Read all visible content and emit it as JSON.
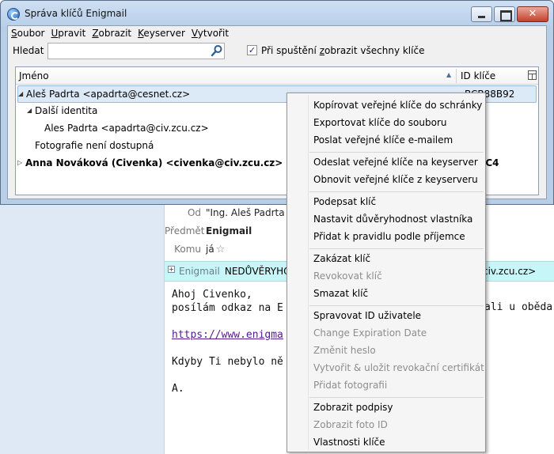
{
  "dialog": {
    "title": "Správa klíčů Enigmail",
    "close_glyph": "✕",
    "menu": [
      {
        "label": "Soubor",
        "mnemonic": "S",
        "rest": "oubor"
      },
      {
        "label": "Upravit",
        "mnemonic": "U",
        "rest": "pravit"
      },
      {
        "label": "Zobrazit",
        "mnemonic": "Z",
        "rest": "obrazit"
      },
      {
        "label": "Keyserver",
        "mnemonic": "K",
        "rest": "eyserver"
      },
      {
        "label": "Vytvořit",
        "mnemonic": "V",
        "rest": "ytvořit"
      }
    ],
    "search": {
      "label": "Hledat",
      "value": "",
      "placeholder": ""
    },
    "show_all_checkbox": {
      "checked": true,
      "check_glyph": "✓",
      "label_pre": "Při spuštění ",
      "label_mnemonic": "z",
      "label_post": "obrazit všechny klíče"
    },
    "tree": {
      "col_name": "Jméno",
      "col_id": "ID klíče",
      "rows": [
        {
          "twisty": "◢",
          "text": "Aleš Padrta <apadrta@cesnet.cz>",
          "key_id": "BCB88B92",
          "selected": true,
          "bold": false
        },
        {
          "twisty": "◢",
          "text": "Další identita",
          "key_id": "",
          "selected": false,
          "bold": false
        },
        {
          "twisty": "",
          "text": "Ales Padrta <apadrta@civ.zcu.cz>",
          "key_id": "",
          "selected": false,
          "bold": false
        },
        {
          "twisty": "",
          "text": "Fotografie není dostupná",
          "key_id": "",
          "selected": false,
          "bold": false
        },
        {
          "twisty": "▷",
          "text": "Anna Nováková (Civenka) <civenka@civ.zcu.cz>",
          "key_id": "8C4",
          "selected": false,
          "bold": true
        }
      ]
    }
  },
  "mail": {
    "from_label": "Od",
    "from_value": "\"Ing. Aleš Padrta P",
    "subject_label": "Předmět",
    "subject_value": "Enigmail",
    "to_label": "Komu",
    "to_value": "já",
    "star_glyph": "☆",
    "plus_glyph": "+",
    "enigmail_label": "Enigmail",
    "enigmail_text": "NEDŮVĚRYHOD",
    "enigmail_tail": "civ.zcu.cz>",
    "body_line1": "Ahoj Civenko,",
    "body_line2": "posílám odkaz na E",
    "body_line2_tail": "ali u oběda",
    "body_link": "https://www.enigma",
    "body_line4": "Kdyby Ti nebylo ně",
    "body_line5": "A."
  },
  "context_menu": {
    "items": [
      {
        "label": "Kopírovat veřejné klíče do schránky",
        "disabled": false
      },
      {
        "label": "Exportovat klíče do souboru",
        "disabled": false
      },
      {
        "label": "Poslat veřejné klíče e-mailem",
        "disabled": false
      },
      {
        "label": "Odeslat veřejné klíče na keyserver",
        "disabled": false
      },
      {
        "label": "Obnovit veřejné klíče z keyserveru",
        "disabled": false
      },
      {
        "label": "Podepsat klíč",
        "disabled": false
      },
      {
        "label": "Nastavit důvěryhodnost vlastníka",
        "disabled": false
      },
      {
        "label": "Přidat k pravidlu podle příjemce",
        "disabled": false
      },
      {
        "label": "Zakázat klíč",
        "disabled": false
      },
      {
        "label": "Revokovat klíč",
        "disabled": true
      },
      {
        "label": "Smazat klíč",
        "disabled": false
      },
      {
        "label": "Spravovat ID uživatele",
        "disabled": false
      },
      {
        "label": "Change Expiration Date",
        "disabled": true
      },
      {
        "label": "Změnit heslo",
        "disabled": true
      },
      {
        "label": "Vytvořit & uložit revokační certifikát",
        "disabled": true
      },
      {
        "label": "Přidat fotografii",
        "disabled": true
      },
      {
        "label": "Zobrazit podpisy",
        "disabled": false
      },
      {
        "label": "Zobrazit foto ID",
        "disabled": true
      },
      {
        "label": "Vlastnosti klíče",
        "disabled": false
      }
    ]
  },
  "colors": {
    "selection": "#dceaf8",
    "enigmail_bar": "#c6f6f8",
    "titlebar": "#b9d0ea"
  }
}
